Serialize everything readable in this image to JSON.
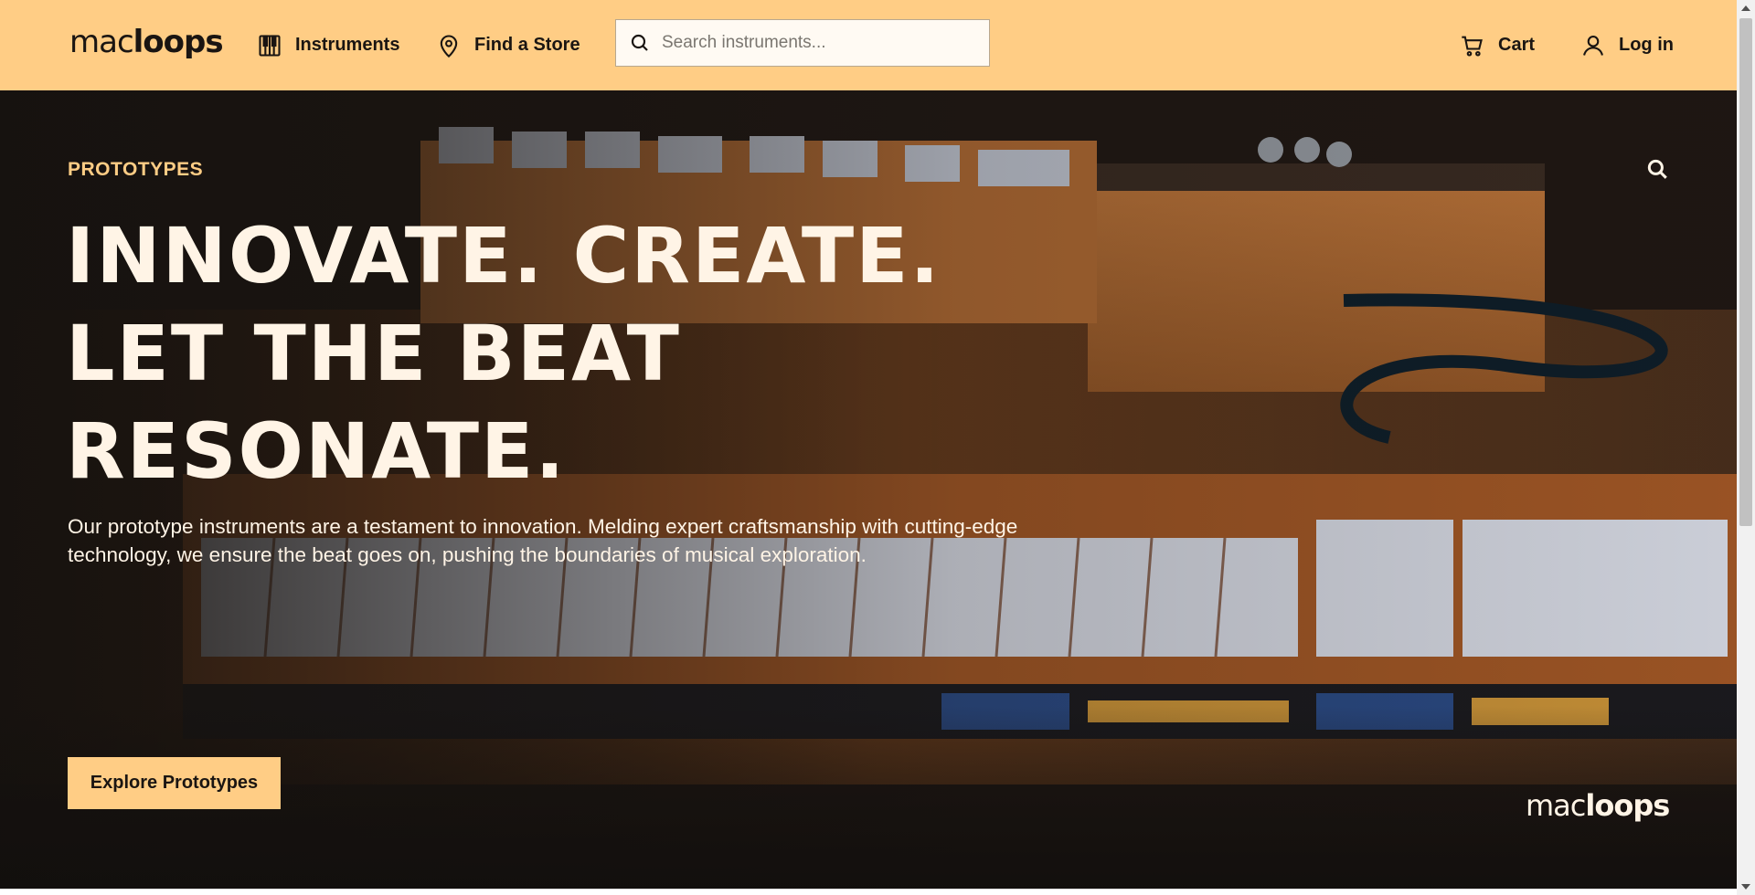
{
  "header": {
    "logo": {
      "light": "mac",
      "bold": "loops"
    },
    "nav": [
      {
        "label": "Instruments",
        "icon": "piano-icon"
      },
      {
        "label": "Find a Store",
        "icon": "map-pin-icon"
      }
    ],
    "search": {
      "placeholder": "Search instruments...",
      "value": ""
    },
    "cart_label": "Cart",
    "login_label": "Log in"
  },
  "hero": {
    "eyebrow": "PROTOTYPES",
    "headline": [
      "INNOVATE. CREATE.",
      "LET THE BEAT",
      "RESONATE."
    ],
    "description": "Our prototype instruments are a testament to innovation. Melding expert craftsmanship with cutting-edge technology, we ensure the beat goes on, pushing the boundaries of musical exploration.",
    "cta_label": "Explore Prototypes",
    "logo": {
      "light": "mac",
      "bold": "loops"
    }
  },
  "colors": {
    "accent": "#ffcd85",
    "dark": "#1a1512",
    "light_text": "#fff4e6"
  }
}
